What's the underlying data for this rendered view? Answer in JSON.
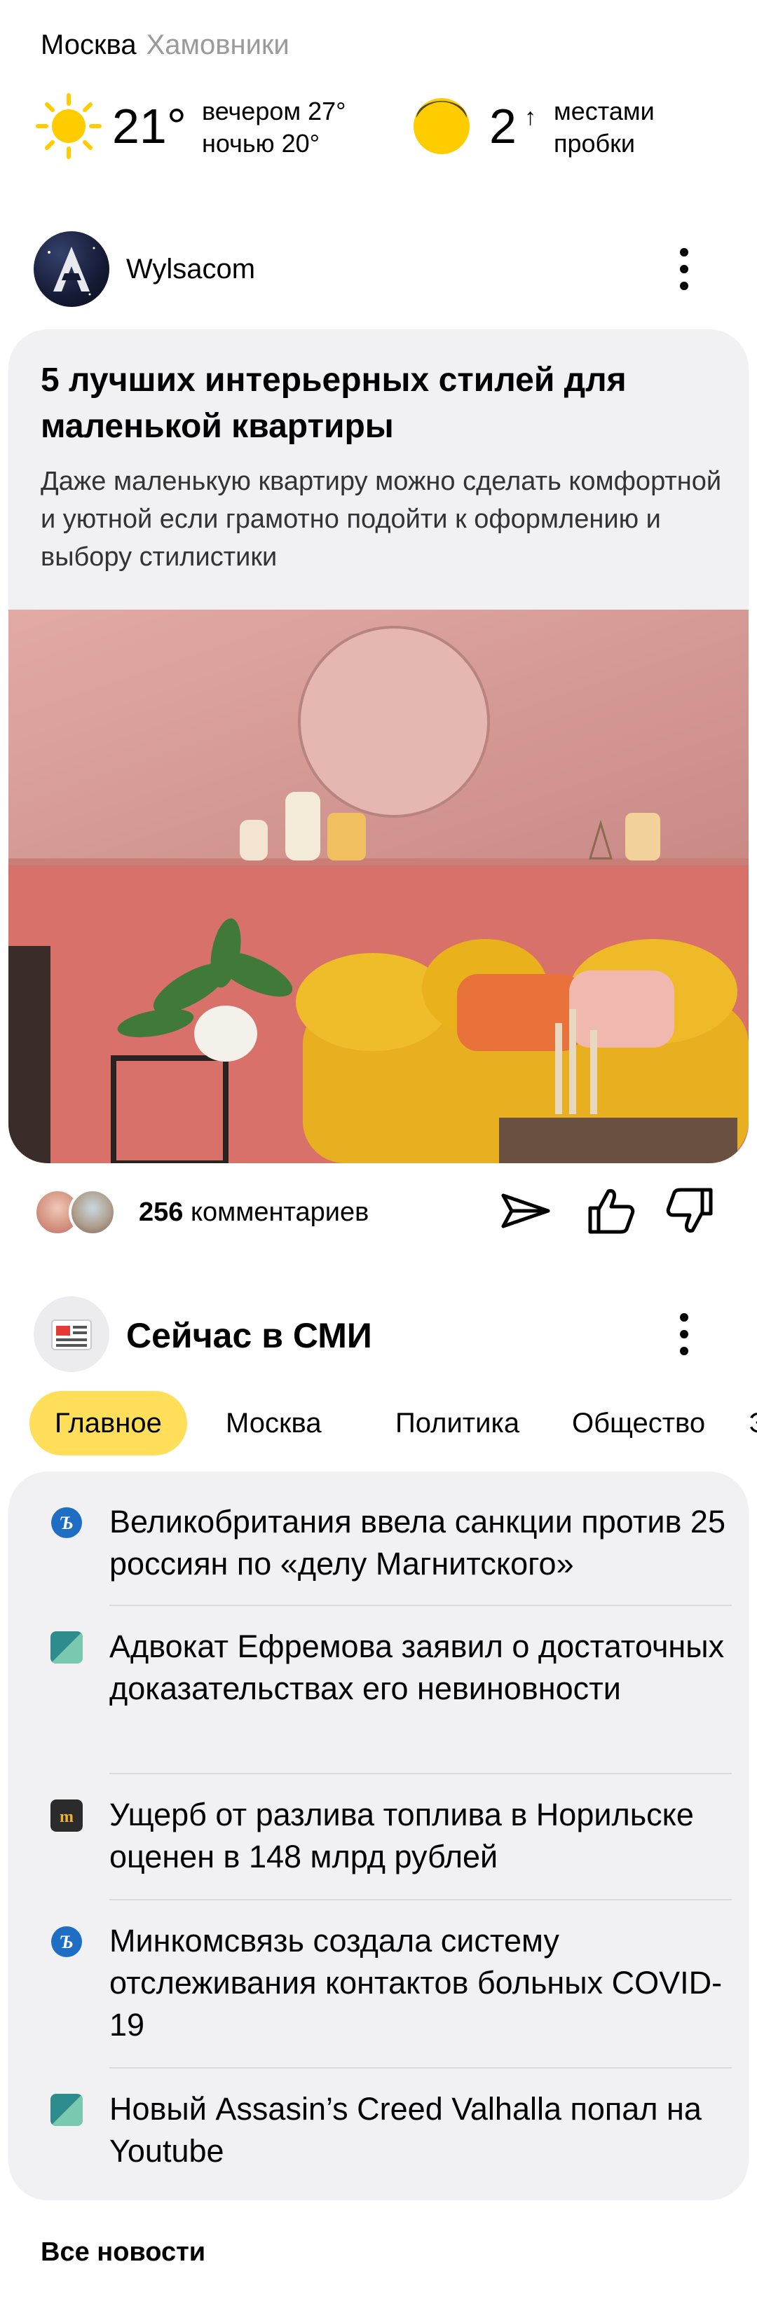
{
  "location": {
    "city": "Москва",
    "district": "Хамовники"
  },
  "weather": {
    "temperature": "21°",
    "evening": "вечером 27°",
    "night": "ночью 20°",
    "traffic_score": "2",
    "traffic_line1": "местами",
    "traffic_line2": "пробки",
    "icon": "sun-icon"
  },
  "article": {
    "channel_name": "Wylsacom",
    "title": "5 лучших интерьерных стилей для маленькой квартиры",
    "text": "Даже маленькую квартиру можно сделать комфортной и уютной если грамотно подойти к оформлению и выбору стилистики",
    "comments_count": "256",
    "comments_label": "комментариев"
  },
  "news": {
    "section_title": "Сейчас в СМИ",
    "tabs": [
      "Главное",
      "Москва",
      "Политика",
      "Общество",
      "Эк"
    ],
    "active_tab": "Главное",
    "items": [
      {
        "text": "Великобритания ввела санкции против 25 россиян по «делу Магнитского»",
        "source_icon": "kommersant-icon"
      },
      {
        "text": "Адвокат Ефремова заявил о достаточных доказательствах его невиновности",
        "source_icon": "rbc-icon"
      },
      {
        "text": "Ущерб от разлива топлива в Норильске оценен в 148 млрд рублей",
        "source_icon": "meduza-icon"
      },
      {
        "text": "Минкомсвязь создала систему отслеживания контактов больных COVID-19",
        "source_icon": "kommersant-icon"
      },
      {
        "text": "Новый Assasin’s Creed Valhalla попал на Youtube",
        "source_icon": "rbc-icon"
      }
    ],
    "all_news_label": "Все новости"
  },
  "colors": {
    "accent": "#ffdf5a",
    "card_bg": "#f1f1f4",
    "sun": "#ffcc00",
    "secondary_text": "#9a9a9a"
  }
}
